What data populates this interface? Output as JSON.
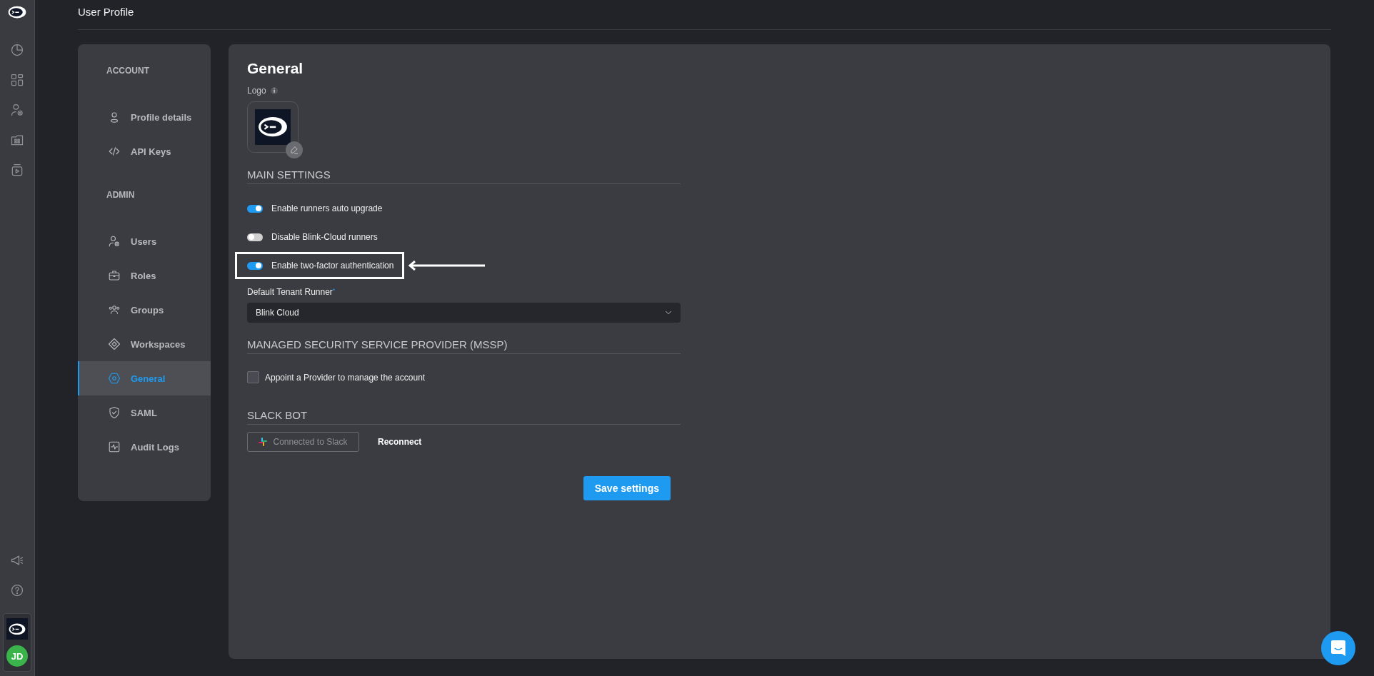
{
  "page_title": "User Profile",
  "rail": {
    "avatar": "JD"
  },
  "sidebar": {
    "sections": [
      {
        "heading": "ACCOUNT",
        "items": [
          {
            "label": "Profile details",
            "selected": false
          },
          {
            "label": "API Keys",
            "selected": false
          }
        ]
      },
      {
        "heading": "ADMIN",
        "items": [
          {
            "label": "Users",
            "selected": false
          },
          {
            "label": "Roles",
            "selected": false
          },
          {
            "label": "Groups",
            "selected": false
          },
          {
            "label": "Workspaces",
            "selected": false
          },
          {
            "label": "General",
            "selected": true
          },
          {
            "label": "SAML",
            "selected": false
          },
          {
            "label": "Audit Logs",
            "selected": false
          }
        ]
      }
    ]
  },
  "general": {
    "title": "General",
    "logo_label": "Logo",
    "main_settings": {
      "heading": "MAIN SETTINGS",
      "toggles": [
        {
          "label": "Enable runners auto upgrade",
          "on": true,
          "highlighted": false
        },
        {
          "label": "Disable Blink-Cloud runners",
          "on": false,
          "highlighted": false
        },
        {
          "label": "Enable two-factor authentication",
          "on": true,
          "highlighted": true
        }
      ],
      "runner_label": "Default Tenant Runner",
      "required_mark": "*",
      "runner_value": "Blink Cloud"
    },
    "mssp": {
      "heading": "MANAGED SECURITY SERVICE PROVIDER (MSSP)",
      "checkbox": {
        "label": "Appoint a Provider to manage the account",
        "checked": false
      }
    },
    "slack": {
      "heading": "SLACK BOT",
      "connected_button": {
        "label": "Connected to Slack",
        "disabled": true
      },
      "reconnect": "Reconnect"
    },
    "save_button": "Save settings"
  }
}
